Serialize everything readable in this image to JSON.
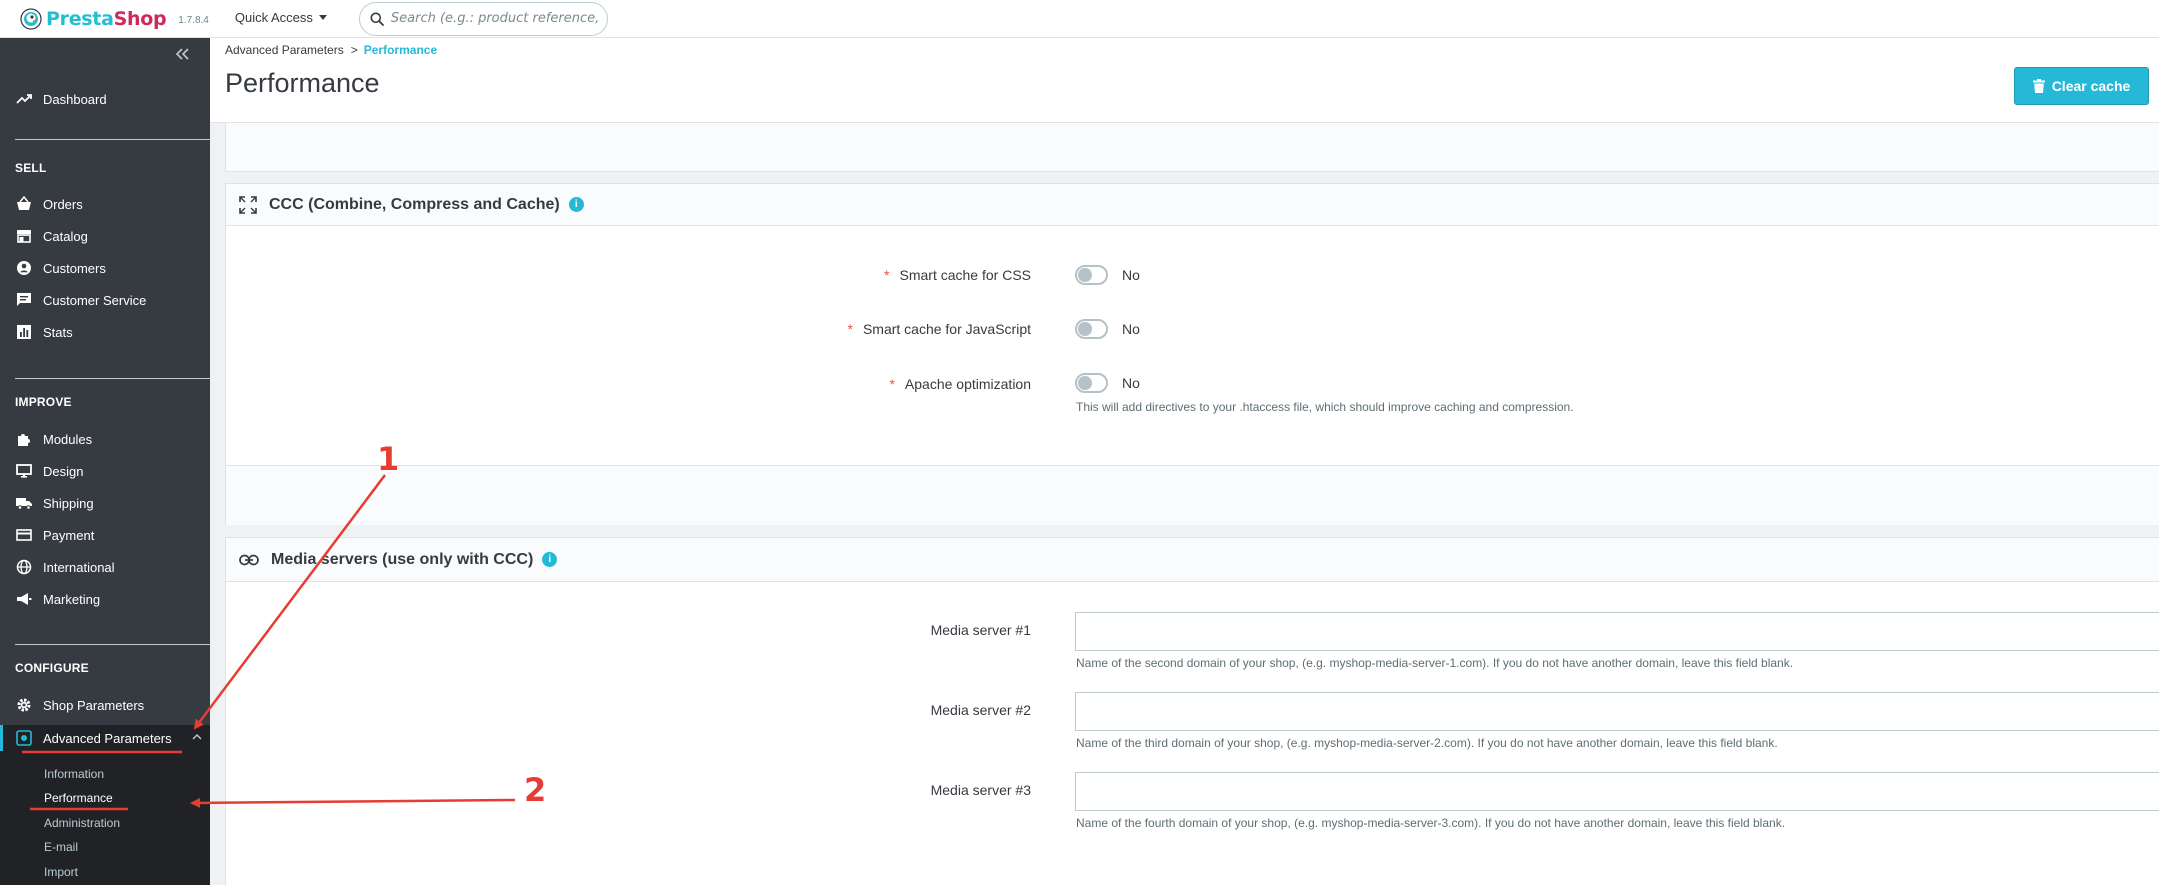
{
  "header": {
    "logo_text_pre": "Presta",
    "logo_text_shop": "Shop",
    "version": "1.7.8.4",
    "quick_access": "Quick Access",
    "search_placeholder": "Search (e.g.: product reference, custon"
  },
  "sidebar": {
    "dashboard": "Dashboard",
    "sections": {
      "sell": "SELL",
      "improve": "IMPROVE",
      "configure": "CONFIGURE"
    },
    "sell_items": [
      "Orders",
      "Catalog",
      "Customers",
      "Customer Service",
      "Stats"
    ],
    "improve_items": [
      "Modules",
      "Design",
      "Shipping",
      "Payment",
      "International",
      "Marketing"
    ],
    "configure_items": [
      "Shop Parameters",
      "Advanced Parameters"
    ],
    "sub_items": [
      "Information",
      "Performance",
      "Administration",
      "E-mail",
      "Import"
    ]
  },
  "breadcrumb": {
    "parent": "Advanced Parameters",
    "separator": ">",
    "current": "Performance"
  },
  "page": {
    "title": "Performance",
    "clear_cache_label": "Clear cache"
  },
  "ccc_panel": {
    "title": "CCC (Combine, Compress and Cache)",
    "info": "i",
    "fields": [
      {
        "label": "Smart cache for CSS",
        "value": "No",
        "required": "*"
      },
      {
        "label": "Smart cache for JavaScript",
        "value": "No",
        "required": "*"
      },
      {
        "label": "Apache optimization",
        "value": "No",
        "required": "*",
        "help": "This will add directives to your .htaccess file, which should improve caching and compression."
      }
    ]
  },
  "media_panel": {
    "title": "Media servers (use only with CCC)",
    "info": "i",
    "fields": [
      {
        "label": "Media server #1",
        "value": "",
        "help": "Name of the second domain of your shop, (e.g. myshop-media-server-1.com). If you do not have another domain, leave this field blank."
      },
      {
        "label": "Media server #2",
        "value": "",
        "help": "Name of the third domain of your shop, (e.g. myshop-media-server-2.com). If you do not have another domain, leave this field blank."
      },
      {
        "label": "Media server #3",
        "value": "",
        "help": "Name of the fourth domain of your shop, (e.g. myshop-media-server-3.com). If you do not have another domain, leave this field blank."
      }
    ]
  },
  "annotations": {
    "one": "1",
    "two": "2",
    "color": "#e53c33"
  },
  "colors": {
    "accent": "#25b9d7",
    "sidebar_bg": "#363a41",
    "sidebar_active_bg": "#202226",
    "required": "#f54c3e"
  }
}
